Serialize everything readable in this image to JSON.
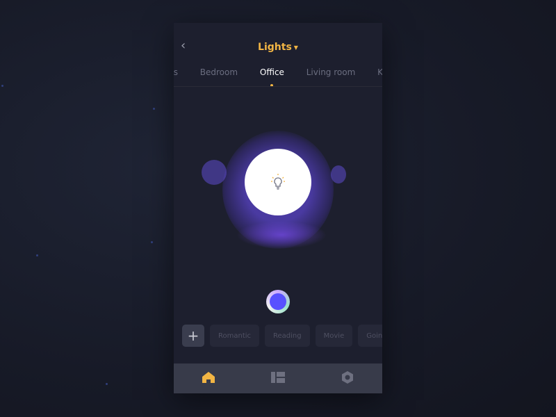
{
  "header": {
    "title": "Lights",
    "back_icon": "chevron-left-icon",
    "dropdown_icon": "caret-down-icon"
  },
  "tabs": [
    {
      "label": "ms"
    },
    {
      "label": "Bedroom"
    },
    {
      "label": "Office",
      "active": true
    },
    {
      "label": "Living room"
    },
    {
      "label": "K"
    }
  ],
  "light": {
    "icon": "lightbulb-icon",
    "color": "#5851ff"
  },
  "scenes": {
    "add_label": "+",
    "items": [
      "Romantic",
      "Reading",
      "Movie",
      "Goin"
    ]
  },
  "nav": [
    {
      "icon": "home-icon",
      "active": true,
      "color": "#f2b544"
    },
    {
      "icon": "dashboard-icon"
    },
    {
      "icon": "settings-hexagon-icon"
    }
  ]
}
